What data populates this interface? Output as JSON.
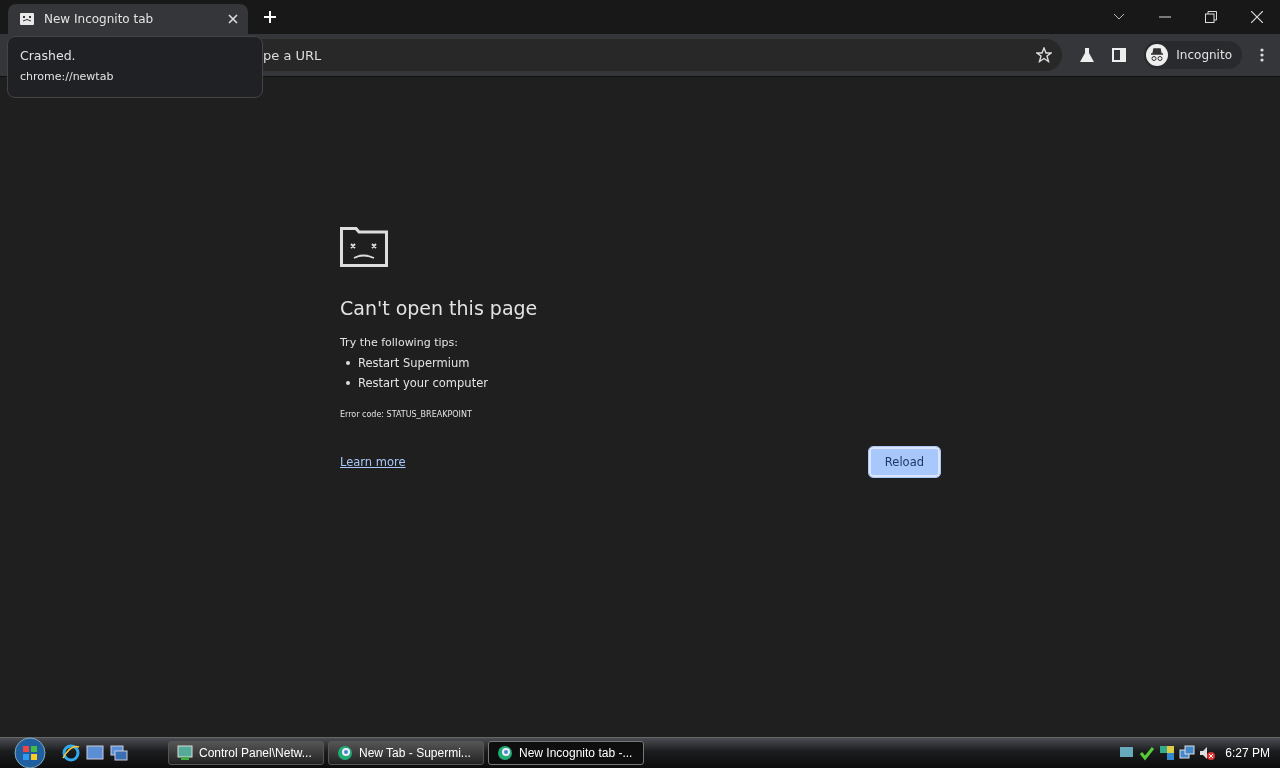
{
  "tabs": [
    {
      "title": "New Incognito tab",
      "selected": true
    }
  ],
  "tooltip": {
    "title": "Crashed.",
    "url": "chrome://newtab"
  },
  "omnibox": {
    "placeholder": "pe a URL"
  },
  "profile": {
    "label": "Incognito"
  },
  "error": {
    "title": "Can't open this page",
    "tips_heading": "Try the following tips:",
    "tips": [
      "Restart Supermium",
      "Restart your computer"
    ],
    "code": "Error code: STATUS_BREAKPOINT",
    "link": "Learn more",
    "button": "Reload"
  },
  "taskbar": {
    "tasks": [
      {
        "label": "Control Panel\\Netw...",
        "kind": "panel",
        "selected": false
      },
      {
        "label": "New Tab - Supermi...",
        "kind": "browser",
        "selected": false
      },
      {
        "label": "New Incognito tab -...",
        "kind": "browser",
        "selected": true
      }
    ],
    "clock": "6:27 PM"
  }
}
